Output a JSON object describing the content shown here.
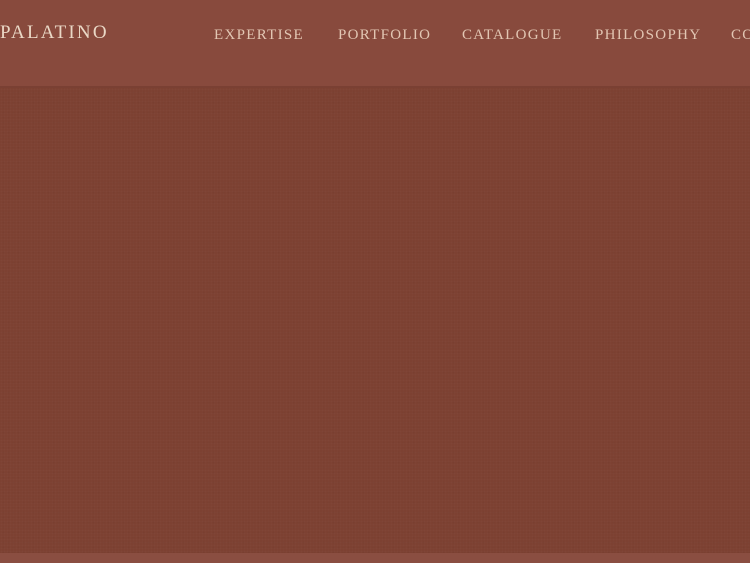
{
  "brand": {
    "name": "PALATINO"
  },
  "nav": {
    "items": [
      {
        "label": "EXPERTISE"
      },
      {
        "label": "PORTFOLIO"
      },
      {
        "label": "CATALOGUE"
      },
      {
        "label": "PHILOSOPHY"
      },
      {
        "label": "CO"
      }
    ]
  },
  "colors": {
    "header_bg": "#884a3d",
    "page_bg": "#7d4132",
    "logo_text": "#ead8c6",
    "nav_text": "#e2c6b3"
  }
}
